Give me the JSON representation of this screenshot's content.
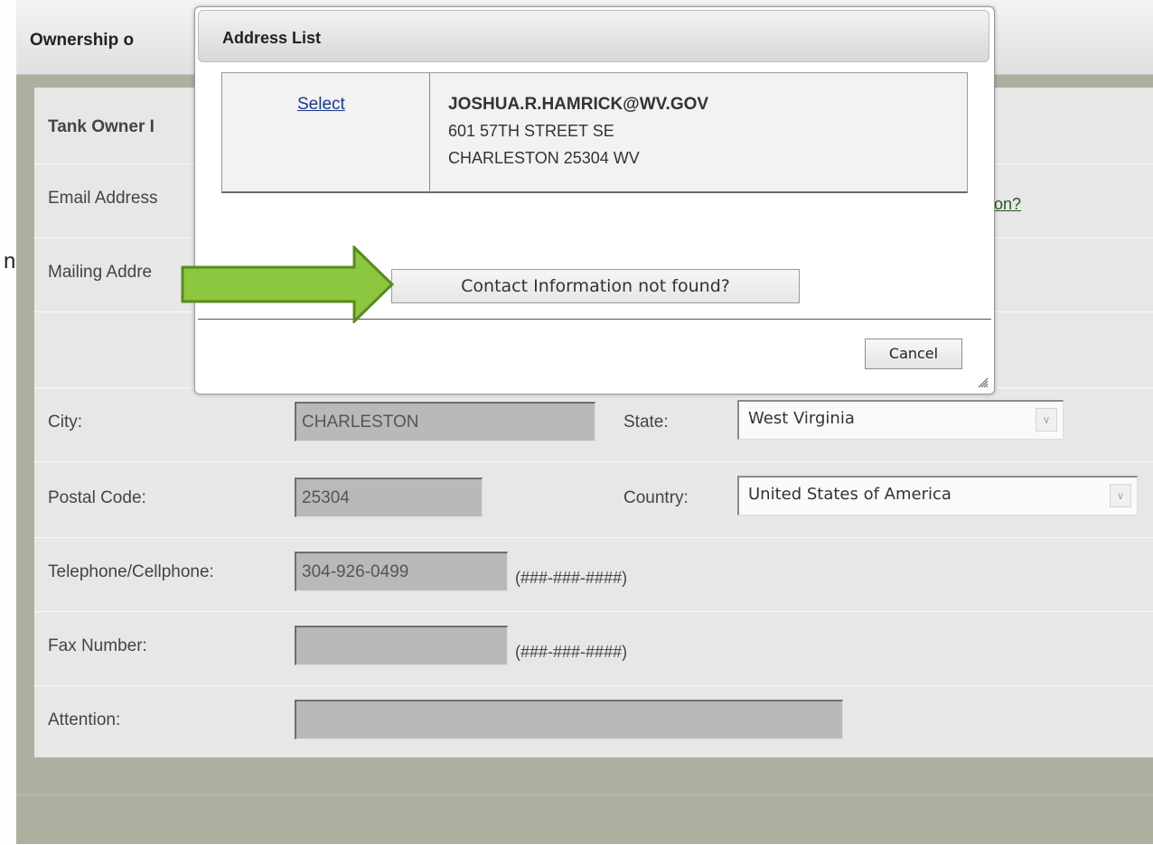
{
  "slide_edge_char": "n",
  "section": {
    "title": "Ownership o"
  },
  "form": {
    "tank_owner_label": "Tank Owner I",
    "email_label": "Email Address",
    "email_link_fragment": "on?",
    "mailing_label": "Mailing Addre",
    "city_label": "City:",
    "city_value": "CHARLESTON",
    "state_label": "State:",
    "state_value": "West Virginia",
    "postal_label": "Postal Code:",
    "postal_value": "25304",
    "country_label": "Country:",
    "country_value": "United States of America",
    "phone_label": "Telephone/Cellphone:",
    "phone_value": "304-926-0499",
    "phone_hint": "(###-###-####)",
    "fax_label": "Fax Number:",
    "fax_value": "",
    "fax_hint": "(###-###-####)",
    "attention_label": "Attention:",
    "attention_value": ""
  },
  "dialog": {
    "title": "Address List",
    "rows": [
      {
        "select_label": "Select",
        "email": "JOSHUA.R.HAMRICK@WV.GOV",
        "line1": "601 57TH STREET SE",
        "line2": "CHARLESTON 25304 WV"
      }
    ],
    "not_found_button": "Contact Information not found?",
    "cancel_button": "Cancel"
  },
  "colors": {
    "annotation_arrow_fill": "#8dc63f",
    "annotation_arrow_stroke": "#5a8a1f",
    "frame_background": "#afaf9f",
    "form_background": "#e7e7e7"
  },
  "icons": {
    "select_dropdown": "chevron-down-icon",
    "dialog_resize": "resize-grip-icon",
    "annotation": "right-arrow-icon"
  }
}
